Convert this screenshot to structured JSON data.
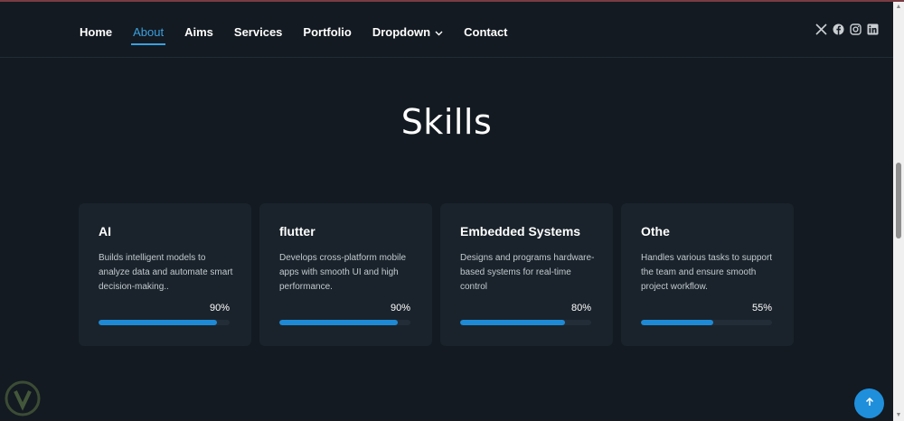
{
  "nav": {
    "items": [
      "Home",
      "About",
      "Aims",
      "Services",
      "Portfolio",
      "Dropdown",
      "Contact"
    ],
    "active": "About"
  },
  "social": [
    "x-twitter-icon",
    "facebook-icon",
    "instagram-icon",
    "linkedin-icon"
  ],
  "section": {
    "title": "Skills"
  },
  "skills": [
    {
      "title": "AI",
      "desc": "Builds intelligent models to analyze data and automate smart decision-making..",
      "percent_label": "90%",
      "percent": 90
    },
    {
      "title": "flutter",
      "desc": "Develops cross-platform mobile apps with smooth UI and high performance.",
      "percent_label": "90%",
      "percent": 90
    },
    {
      "title": "Embedded Systems",
      "desc": "Designs and programs hardware-based systems for real-time control",
      "percent_label": "80%",
      "percent": 80
    },
    {
      "title": "Othe",
      "desc": "Handles various tasks to support the team and ensure smooth project workflow.",
      "percent_label": "55%",
      "percent": 55
    }
  ],
  "colors": {
    "accent": "#1e8ad6",
    "background": "#131a21",
    "card": "#1a232b"
  }
}
